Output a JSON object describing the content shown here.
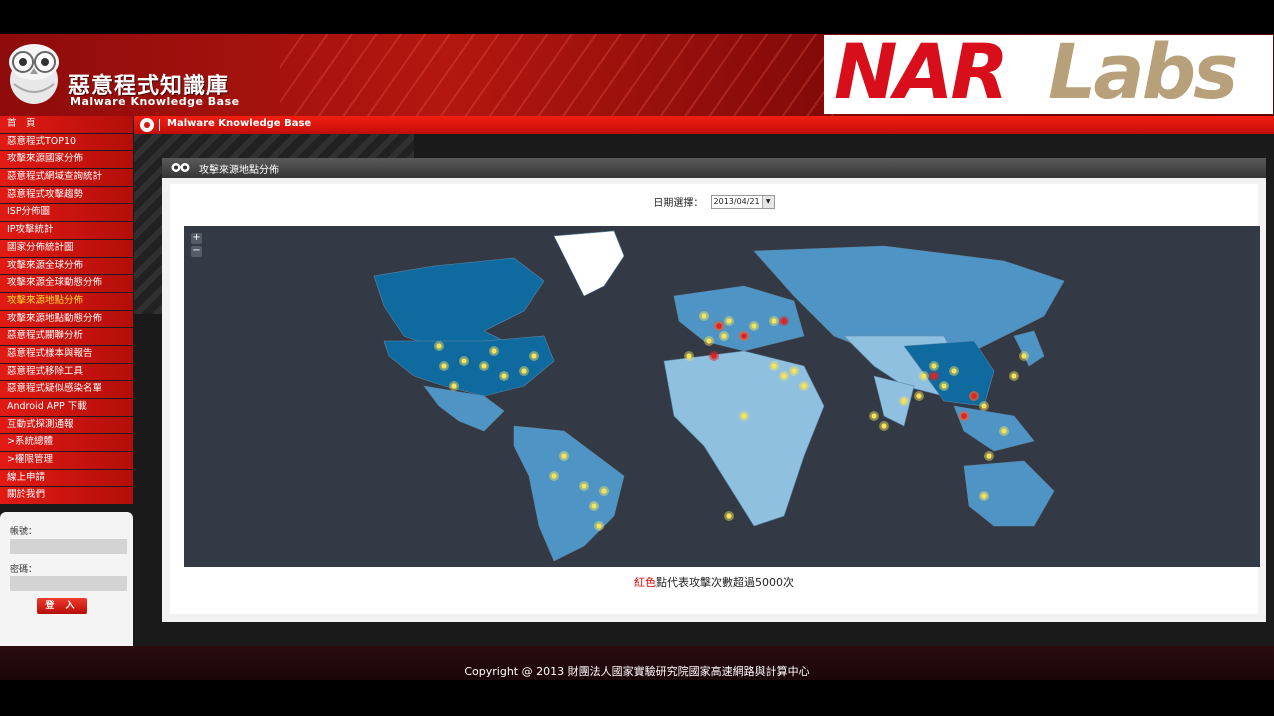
{
  "header": {
    "brand_cn": "惡意程式知識庫",
    "brand_en": "Malware Knowledge Base",
    "partner_logo_nar": "NAR",
    "partner_logo_labs": "Labs"
  },
  "topbar": {
    "title": "Malware Knowledge Base"
  },
  "sidebar": {
    "items": [
      {
        "label": "首　頁"
      },
      {
        "label": "惡意程式TOP10"
      },
      {
        "label": "攻擊來源國家分佈"
      },
      {
        "label": "惡意程式網域查詢統計"
      },
      {
        "label": "惡意程式攻擊趨勢"
      },
      {
        "label": "ISP分佈圖"
      },
      {
        "label": "IP攻擊統計"
      },
      {
        "label": "國家分佈統計圖"
      },
      {
        "label": "攻擊來源全球分佈"
      },
      {
        "label": "攻擊來源全球動態分佈"
      },
      {
        "label": "攻擊來源地點分佈"
      },
      {
        "label": "攻擊來源地點動態分佈"
      },
      {
        "label": "惡意程式關聯分析"
      },
      {
        "label": "惡意程式樣本與報告"
      },
      {
        "label": "惡意程式移除工具"
      },
      {
        "label": "惡意程式疑似感染名單"
      },
      {
        "label": "Android APP 下載"
      },
      {
        "label": "互動式探測通報"
      },
      {
        "label": ">系統總體"
      },
      {
        "label": ">權限管理"
      },
      {
        "label": "線上申請"
      },
      {
        "label": "關於我們"
      }
    ],
    "active_index": 10
  },
  "login": {
    "account_label": "帳號：",
    "password_label": "密碼：",
    "account_value": "",
    "password_value": "",
    "submit_label": "登 入"
  },
  "panel": {
    "title": "攻擊來源地點分佈",
    "date_label": "日期選擇：",
    "date_value": "2013/04/21",
    "zoom_in": "+",
    "zoom_out": "−",
    "legend_red": "紅色",
    "legend_rest": "點代表攻擊次數超過5000次"
  },
  "footer": {
    "copyright": "Copyright @ 2013 財團法人國家實驗研究院國家高速網路與計算中心"
  },
  "colors": {
    "accent_red": "#d21710",
    "active_nav_text": "#ffdf2a",
    "map_ocean": "#333a46",
    "land_light": "#8fc0df",
    "land_mid": "#4e95c6",
    "land_dark": "#0e6a9f",
    "dot_yellow": "#f7e35a",
    "dot_red": "#e02222"
  }
}
